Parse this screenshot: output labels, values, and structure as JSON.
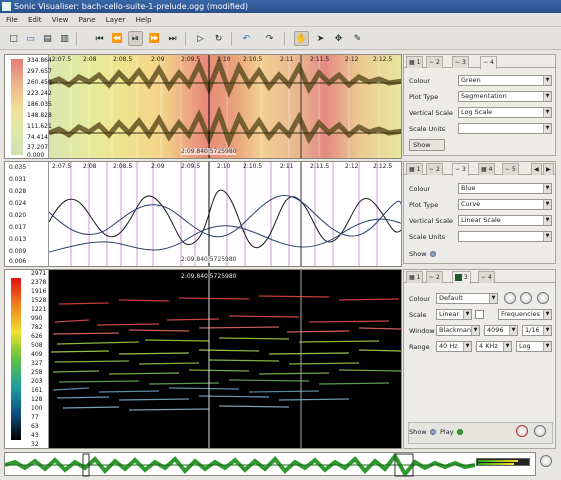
{
  "window": {
    "title": "Sonic Visualiser: bach-cello-suite-1-prelude.ogg (modified)"
  },
  "menu": [
    "File",
    "Edit",
    "View",
    "Pane",
    "Layer",
    "Help"
  ],
  "toolbar": {
    "icons": [
      "new-icon",
      "open-icon",
      "save-icon",
      "save-as-icon",
      "rewind-start-icon",
      "rewind-icon",
      "play-pause-icon",
      "fast-forward-icon",
      "forward-end-icon",
      "play-selection-icon",
      "loop-icon",
      "undo-icon",
      "redo-icon",
      "navigate-icon",
      "select-icon",
      "move-icon",
      "draw-icon"
    ]
  },
  "pane1": {
    "scale_ticks": [
      "334.864",
      "297.657",
      "260.450",
      "223.242",
      "186.035",
      "148.828",
      "111.621",
      "74.414",
      "37.207",
      "0.000"
    ],
    "ruler": [
      "2:07.5",
      "2:08",
      "2:08.5",
      "2:09",
      "2:09.5",
      "2:10",
      "2:10.5",
      "2:11",
      "2:11.5",
      "2:12",
      "2:12.5"
    ],
    "cursor": "2:09.840  5725980"
  },
  "pane2": {
    "scale_ticks": [
      "0.035",
      "0.031",
      "0.028",
      "0.024",
      "0.020",
      "0.017",
      "0.013",
      "0.009",
      "0.006"
    ],
    "ruler": [
      "2:07.5",
      "2:08",
      "2:08.5",
      "2:09",
      "2:09.5",
      "2:10",
      "2:10.5",
      "2:11",
      "2:11.5",
      "2:12",
      "2:12.5"
    ],
    "cursor": "2:09.840  5725980"
  },
  "pane3": {
    "scale_ticks": [
      "2971",
      "2378",
      "1916",
      "1528",
      "1221",
      "990",
      "782",
      "626",
      "508",
      "409",
      "327",
      "258",
      "203",
      "161",
      "128",
      "100",
      "77",
      "63",
      "43",
      "32"
    ],
    "cursor": "2:09.840  5725980"
  },
  "panel1": {
    "tabs": [
      "1",
      "2",
      "3",
      "4"
    ],
    "colour_label": "Colour",
    "colour": "Green",
    "plot_label": "Plot Type",
    "plot": "Segmentation",
    "vscale_label": "Vertical Scale",
    "vscale": "Log Scale",
    "units_label": "Scale Units",
    "units": "",
    "show": "Show"
  },
  "panel2": {
    "tabs": [
      "1",
      "2",
      "3",
      "4",
      "5"
    ],
    "colour_label": "Colour",
    "colour": "Blue",
    "plot_label": "Plot Type",
    "plot": "Curve",
    "vscale_label": "Vertical Scale",
    "vscale": "Linear Scale",
    "units_label": "Scale Units",
    "units": "",
    "show": "Show"
  },
  "panel3": {
    "tabs": [
      "1",
      "2",
      "3",
      "4"
    ],
    "colour_label": "Colour",
    "colour": "Default",
    "scale_label": "Scale",
    "scale": "Linear",
    "scale_mode": "Frequencies",
    "window_label": "Window",
    "window": "Blackman",
    "window_size": "4096",
    "window_overlap": "1/16",
    "range_label": "Range",
    "range_min": "40 Hz",
    "range_max": "4 KHz",
    "range_scale": "Log",
    "show": "Show",
    "play": "Play"
  },
  "colors": {
    "accent": "#2f6ec3",
    "green_led": "#2fa52f",
    "wave": "#5a4a1c",
    "overview": "#2e9a2e"
  }
}
